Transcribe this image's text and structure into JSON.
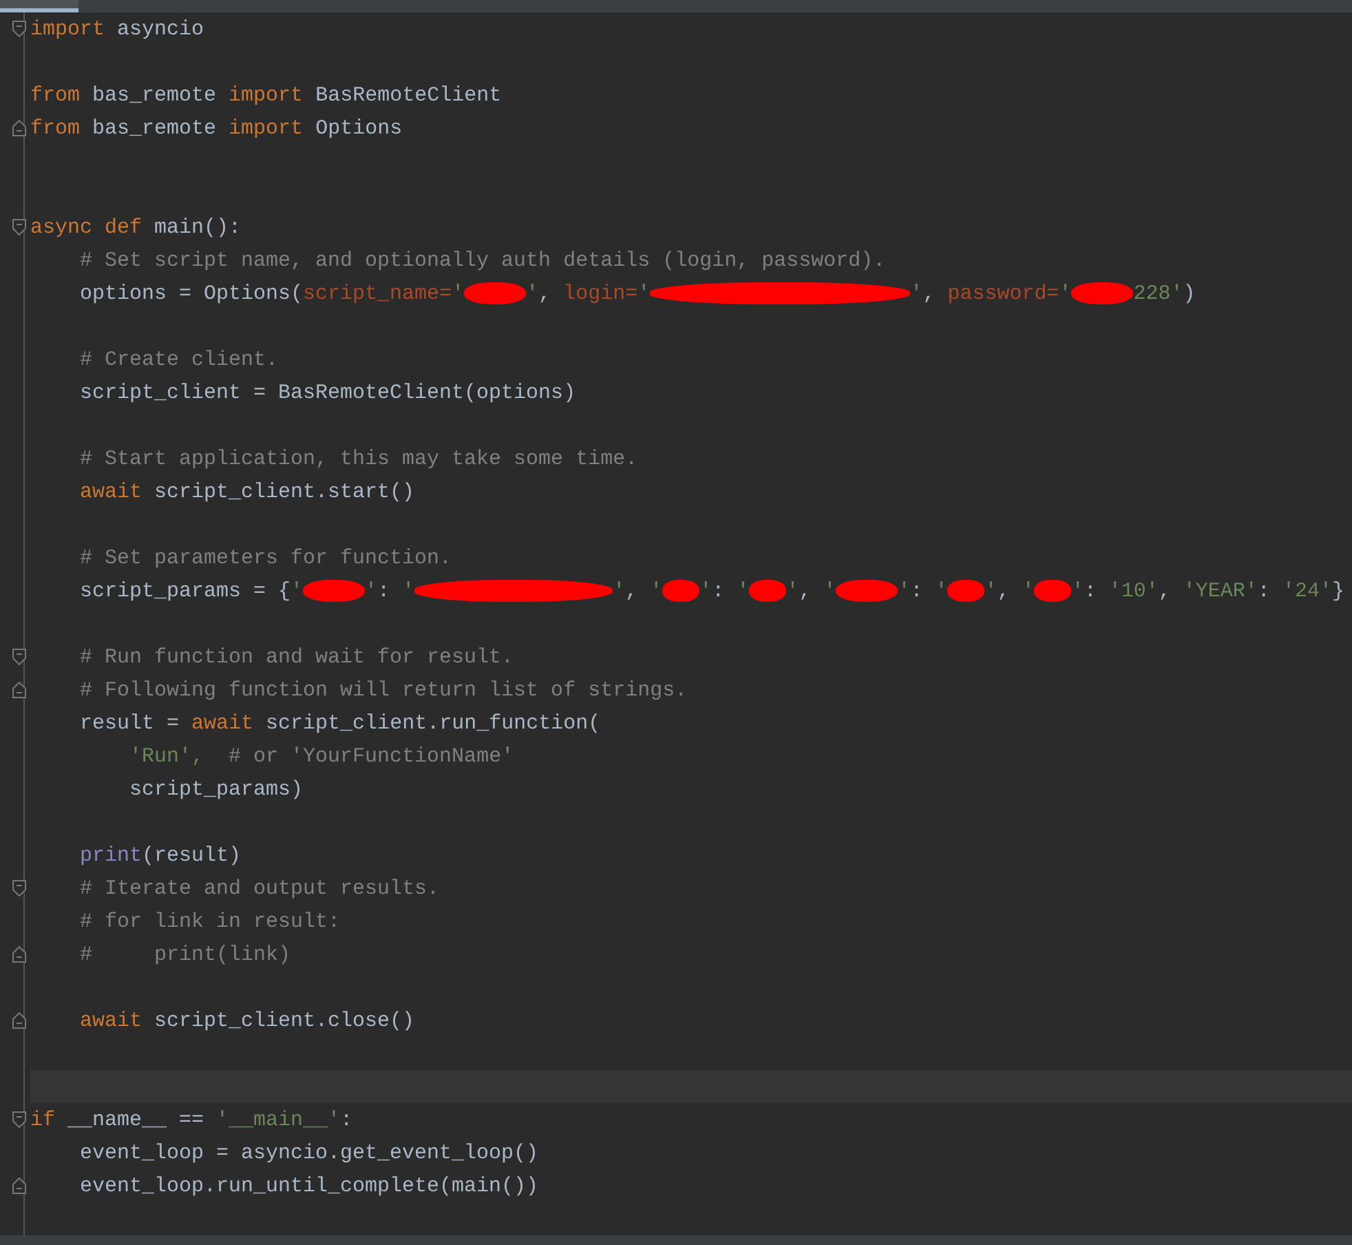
{
  "editor": {
    "tabs": [
      {
        "selected": true
      }
    ],
    "lines": [
      {
        "kind": "code",
        "fold_start": true,
        "tokens": [
          {
            "kind": "keyword",
            "t": "import"
          },
          {
            "kind": "plain",
            "t": " asyncio"
          }
        ]
      },
      {
        "kind": "blank"
      },
      {
        "kind": "code",
        "tokens": [
          {
            "kind": "keyword",
            "t": "from"
          },
          {
            "kind": "plain",
            "t": " bas_remote "
          },
          {
            "kind": "keyword",
            "t": "import"
          },
          {
            "kind": "plain",
            "t": " BasRemoteClient"
          }
        ]
      },
      {
        "kind": "code",
        "fold_end": true,
        "tokens": [
          {
            "kind": "keyword",
            "t": "from"
          },
          {
            "kind": "plain",
            "t": " bas_remote "
          },
          {
            "kind": "keyword",
            "t": "import"
          },
          {
            "kind": "plain",
            "t": " Options"
          }
        ]
      },
      {
        "kind": "blank"
      },
      {
        "kind": "blank"
      },
      {
        "kind": "code",
        "fold_start": true,
        "tokens": [
          {
            "kind": "keyword",
            "t": "async def"
          },
          {
            "kind": "plain",
            "t": " main():"
          }
        ]
      },
      {
        "kind": "code",
        "tokens": [
          {
            "kind": "comment",
            "t": "    # Set script name, and optionally auth details (login, password)."
          }
        ]
      },
      {
        "kind": "code",
        "tokens": [
          {
            "kind": "plain",
            "t": "    options = Options("
          },
          {
            "kind": "param",
            "t": "script_name="
          },
          {
            "kind": "string",
            "t": "'"
          },
          {
            "kind": "blot"
          },
          {
            "kind": "string",
            "t": "'"
          },
          {
            "kind": "plain",
            "t": ", "
          },
          {
            "kind": "param",
            "t": "login="
          },
          {
            "kind": "string",
            "t": "'"
          },
          {
            "kind": "streak"
          },
          {
            "kind": "string",
            "t": "'"
          },
          {
            "kind": "plain",
            "t": ", "
          },
          {
            "kind": "param",
            "t": "password="
          },
          {
            "kind": "string",
            "t": "'"
          },
          {
            "kind": "blot"
          },
          {
            "kind": "string",
            "t": "228'"
          },
          {
            "kind": "plain",
            "t": ")"
          }
        ]
      },
      {
        "kind": "blank"
      },
      {
        "kind": "code",
        "tokens": [
          {
            "kind": "comment",
            "t": "    # Create client."
          }
        ]
      },
      {
        "kind": "code",
        "tokens": [
          {
            "kind": "plain",
            "t": "    script_client = BasRemoteClient(options)"
          }
        ]
      },
      {
        "kind": "blank"
      },
      {
        "kind": "code",
        "tokens": [
          {
            "kind": "comment",
            "t": "    # Start application, this may take some time."
          }
        ]
      },
      {
        "kind": "code",
        "tokens": [
          {
            "kind": "keyword",
            "t": "    await"
          },
          {
            "kind": "plain",
            "t": " script_client.start()"
          }
        ]
      },
      {
        "kind": "blank"
      },
      {
        "kind": "code",
        "tokens": [
          {
            "kind": "comment",
            "t": "    # Set parameters for function."
          }
        ]
      },
      {
        "kind": "code",
        "tokens": [
          {
            "kind": "plain",
            "t": "    script_params = {"
          },
          {
            "kind": "string",
            "t": "'"
          },
          {
            "kind": "blot"
          },
          {
            "kind": "string",
            "t": "'"
          },
          {
            "kind": "plain",
            "t": ": "
          },
          {
            "kind": "string",
            "t": "'"
          },
          {
            "kind": "smear"
          },
          {
            "kind": "string",
            "t": "'"
          },
          {
            "kind": "plain",
            "t": ", "
          },
          {
            "kind": "string",
            "t": "'"
          },
          {
            "kind": "dot"
          },
          {
            "kind": "string",
            "t": "'"
          },
          {
            "kind": "plain",
            "t": ": "
          },
          {
            "kind": "string",
            "t": "'"
          },
          {
            "kind": "dot"
          },
          {
            "kind": "string",
            "t": "'"
          },
          {
            "kind": "plain",
            "t": ", "
          },
          {
            "kind": "string",
            "t": "'"
          },
          {
            "kind": "blot"
          },
          {
            "kind": "string",
            "t": "'"
          },
          {
            "kind": "plain",
            "t": ": "
          },
          {
            "kind": "string",
            "t": "'"
          },
          {
            "kind": "dot"
          },
          {
            "kind": "string",
            "t": "'"
          },
          {
            "kind": "plain",
            "t": ", "
          },
          {
            "kind": "string",
            "t": "'"
          },
          {
            "kind": "dot"
          },
          {
            "kind": "string",
            "t": "'"
          },
          {
            "kind": "plain",
            "t": ": "
          },
          {
            "kind": "string",
            "t": "'10'"
          },
          {
            "kind": "plain",
            "t": ", "
          },
          {
            "kind": "string",
            "t": "'YEAR'"
          },
          {
            "kind": "plain",
            "t": ": "
          },
          {
            "kind": "string",
            "t": "'24'"
          },
          {
            "kind": "plain",
            "t": "}"
          }
        ]
      },
      {
        "kind": "blank"
      },
      {
        "kind": "code",
        "fold_start": true,
        "tokens": [
          {
            "kind": "comment",
            "t": "    # Run function and wait for result."
          }
        ]
      },
      {
        "kind": "code",
        "fold_end": true,
        "tokens": [
          {
            "kind": "comment",
            "t": "    # Following function will return list of strings."
          }
        ]
      },
      {
        "kind": "code",
        "tokens": [
          {
            "kind": "plain",
            "t": "    result = "
          },
          {
            "kind": "keyword",
            "t": "await"
          },
          {
            "kind": "plain",
            "t": " script_client.run_function("
          }
        ]
      },
      {
        "kind": "code",
        "tokens": [
          {
            "kind": "string",
            "t": "        'Run',"
          },
          {
            "kind": "comment",
            "t": "  # or 'YourFunctionName'"
          }
        ]
      },
      {
        "kind": "code",
        "tokens": [
          {
            "kind": "plain",
            "t": "        script_params)"
          }
        ]
      },
      {
        "kind": "blank"
      },
      {
        "kind": "code",
        "tokens": [
          {
            "kind": "builtin",
            "t": "    print"
          },
          {
            "kind": "plain",
            "t": "(result)"
          }
        ]
      },
      {
        "kind": "code",
        "fold_start": true,
        "tokens": [
          {
            "kind": "comment",
            "t": "    # Iterate and output results."
          }
        ]
      },
      {
        "kind": "code",
        "tokens": [
          {
            "kind": "comment",
            "t": "    # for link in result:"
          }
        ]
      },
      {
        "kind": "code",
        "fold_end": true,
        "tokens": [
          {
            "kind": "comment",
            "t": "    #     print(link)"
          }
        ]
      },
      {
        "kind": "blank"
      },
      {
        "kind": "code",
        "fold_end": true,
        "tokens": [
          {
            "kind": "keyword",
            "t": "    await"
          },
          {
            "kind": "plain",
            "t": " script_client.close()"
          }
        ]
      },
      {
        "kind": "blank"
      },
      {
        "kind": "blank",
        "current": true
      },
      {
        "kind": "code",
        "fold_start": true,
        "tokens": [
          {
            "kind": "keyword",
            "t": "if"
          },
          {
            "kind": "plain",
            "t": " __name__ == "
          },
          {
            "kind": "string",
            "t": "'__main__'"
          },
          {
            "kind": "plain",
            "t": ":"
          }
        ]
      },
      {
        "kind": "code",
        "tokens": [
          {
            "kind": "plain",
            "t": "    event_loop = asyncio.get_event_loop()"
          }
        ]
      },
      {
        "kind": "code",
        "fold_end": true,
        "tokens": [
          {
            "kind": "plain",
            "t": "    event_loop.run_until_complete(main())"
          }
        ]
      },
      {
        "kind": "blank"
      }
    ]
  }
}
